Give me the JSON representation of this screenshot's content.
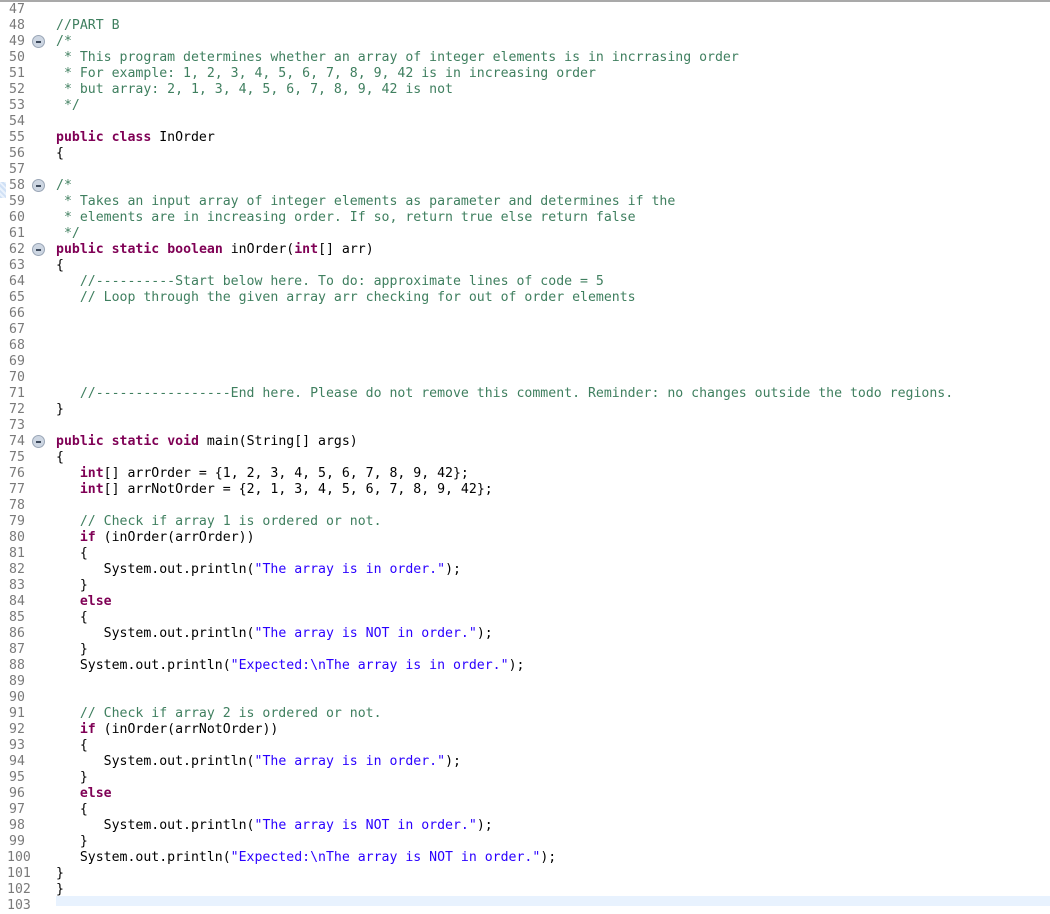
{
  "editor": {
    "lines": [
      {
        "n": "47",
        "fold": false,
        "segs": []
      },
      {
        "n": "48",
        "fold": false,
        "segs": [
          {
            "t": "cm",
            "v": "//PART B"
          }
        ]
      },
      {
        "n": "49",
        "fold": true,
        "segs": [
          {
            "t": "cm",
            "v": "/*"
          }
        ]
      },
      {
        "n": "50",
        "fold": false,
        "segs": [
          {
            "t": "cm",
            "v": " * This program determines whether an array of integer elements is in incrrasing order"
          }
        ]
      },
      {
        "n": "51",
        "fold": false,
        "segs": [
          {
            "t": "cm",
            "v": " * For example: 1, 2, 3, 4, 5, 6, 7, 8, 9, 42 is in increasing order"
          }
        ]
      },
      {
        "n": "52",
        "fold": false,
        "segs": [
          {
            "t": "cm",
            "v": " * but array: 2, 1, 3, 4, 5, 6, 7, 8, 9, 42 is not"
          }
        ]
      },
      {
        "n": "53",
        "fold": false,
        "segs": [
          {
            "t": "cm",
            "v": " */"
          }
        ]
      },
      {
        "n": "54",
        "fold": false,
        "segs": []
      },
      {
        "n": "55",
        "fold": false,
        "segs": [
          {
            "t": "kw",
            "v": "public"
          },
          {
            "t": "",
            "v": " "
          },
          {
            "t": "kw",
            "v": "class"
          },
          {
            "t": "",
            "v": " InOrder"
          }
        ]
      },
      {
        "n": "56",
        "fold": false,
        "segs": [
          {
            "t": "",
            "v": "{"
          }
        ]
      },
      {
        "n": "57",
        "fold": false,
        "segs": []
      },
      {
        "n": "58",
        "fold": true,
        "segs": [
          {
            "t": "cm",
            "v": "/*"
          }
        ]
      },
      {
        "n": "59",
        "fold": false,
        "segs": [
          {
            "t": "cm",
            "v": " * Takes an input array of integer elements as parameter and determines if the"
          }
        ]
      },
      {
        "n": "60",
        "fold": false,
        "segs": [
          {
            "t": "cm",
            "v": " * elements are in increasing order. If so, return true else return false"
          }
        ]
      },
      {
        "n": "61",
        "fold": false,
        "segs": [
          {
            "t": "cm",
            "v": " */"
          }
        ]
      },
      {
        "n": "62",
        "fold": true,
        "segs": [
          {
            "t": "kw",
            "v": "public"
          },
          {
            "t": "",
            "v": " "
          },
          {
            "t": "kw",
            "v": "static"
          },
          {
            "t": "",
            "v": " "
          },
          {
            "t": "kw",
            "v": "boolean"
          },
          {
            "t": "",
            "v": " inOrder("
          },
          {
            "t": "kw",
            "v": "int"
          },
          {
            "t": "",
            "v": "[] arr)"
          }
        ]
      },
      {
        "n": "63",
        "fold": false,
        "segs": [
          {
            "t": "",
            "v": "{"
          }
        ]
      },
      {
        "n": "64",
        "fold": false,
        "segs": [
          {
            "t": "cm",
            "v": "   //----------Start below here. To do: approximate lines of code = 5"
          }
        ]
      },
      {
        "n": "65",
        "fold": false,
        "segs": [
          {
            "t": "cm",
            "v": "   // Loop through the given array arr checking for out of order elements"
          }
        ]
      },
      {
        "n": "66",
        "fold": false,
        "segs": []
      },
      {
        "n": "67",
        "fold": false,
        "segs": []
      },
      {
        "n": "68",
        "fold": false,
        "segs": []
      },
      {
        "n": "69",
        "fold": false,
        "segs": []
      },
      {
        "n": "70",
        "fold": false,
        "segs": []
      },
      {
        "n": "71",
        "fold": false,
        "segs": [
          {
            "t": "cm",
            "v": "   //-----------------End here. Please do not remove this comment. Reminder: no changes outside the todo regions."
          }
        ]
      },
      {
        "n": "72",
        "fold": false,
        "segs": [
          {
            "t": "",
            "v": "}"
          }
        ]
      },
      {
        "n": "73",
        "fold": false,
        "segs": []
      },
      {
        "n": "74",
        "fold": true,
        "segs": [
          {
            "t": "kw",
            "v": "public"
          },
          {
            "t": "",
            "v": " "
          },
          {
            "t": "kw",
            "v": "static"
          },
          {
            "t": "",
            "v": " "
          },
          {
            "t": "kw",
            "v": "void"
          },
          {
            "t": "",
            "v": " main(String[] args)"
          }
        ]
      },
      {
        "n": "75",
        "fold": false,
        "segs": [
          {
            "t": "",
            "v": "{"
          }
        ]
      },
      {
        "n": "76",
        "fold": false,
        "segs": [
          {
            "t": "",
            "v": "   "
          },
          {
            "t": "kw",
            "v": "int"
          },
          {
            "t": "",
            "v": "[] arrOrder = {1, 2, 3, 4, 5, 6, 7, 8, 9, 42};"
          }
        ]
      },
      {
        "n": "77",
        "fold": false,
        "segs": [
          {
            "t": "",
            "v": "   "
          },
          {
            "t": "kw",
            "v": "int"
          },
          {
            "t": "",
            "v": "[] arrNotOrder = {2, 1, 3, 4, 5, 6, 7, 8, 9, 42};"
          }
        ]
      },
      {
        "n": "78",
        "fold": false,
        "segs": []
      },
      {
        "n": "79",
        "fold": false,
        "segs": [
          {
            "t": "cm",
            "v": "   // Check if array 1 is ordered or not."
          }
        ]
      },
      {
        "n": "80",
        "fold": false,
        "segs": [
          {
            "t": "",
            "v": "   "
          },
          {
            "t": "kw",
            "v": "if"
          },
          {
            "t": "",
            "v": " (inOrder(arrOrder))"
          }
        ]
      },
      {
        "n": "81",
        "fold": false,
        "segs": [
          {
            "t": "",
            "v": "   {"
          }
        ]
      },
      {
        "n": "82",
        "fold": false,
        "segs": [
          {
            "t": "",
            "v": "      System.out.println("
          },
          {
            "t": "str",
            "v": "\"The array is in order.\""
          },
          {
            "t": "",
            "v": ");"
          }
        ]
      },
      {
        "n": "83",
        "fold": false,
        "segs": [
          {
            "t": "",
            "v": "   }"
          }
        ]
      },
      {
        "n": "84",
        "fold": false,
        "segs": [
          {
            "t": "",
            "v": "   "
          },
          {
            "t": "kw",
            "v": "else"
          }
        ]
      },
      {
        "n": "85",
        "fold": false,
        "segs": [
          {
            "t": "",
            "v": "   {"
          }
        ]
      },
      {
        "n": "86",
        "fold": false,
        "segs": [
          {
            "t": "",
            "v": "      System.out.println("
          },
          {
            "t": "str",
            "v": "\"The array is NOT in order.\""
          },
          {
            "t": "",
            "v": ");"
          }
        ]
      },
      {
        "n": "87",
        "fold": false,
        "segs": [
          {
            "t": "",
            "v": "   }"
          }
        ]
      },
      {
        "n": "88",
        "fold": false,
        "segs": [
          {
            "t": "",
            "v": "   System.out.println("
          },
          {
            "t": "str",
            "v": "\"Expected:\\nThe array is in order.\""
          },
          {
            "t": "",
            "v": ");"
          }
        ]
      },
      {
        "n": "89",
        "fold": false,
        "segs": []
      },
      {
        "n": "90",
        "fold": false,
        "segs": []
      },
      {
        "n": "91",
        "fold": false,
        "segs": [
          {
            "t": "cm",
            "v": "   // Check if array 2 is ordered or not."
          }
        ]
      },
      {
        "n": "92",
        "fold": false,
        "segs": [
          {
            "t": "",
            "v": "   "
          },
          {
            "t": "kw",
            "v": "if"
          },
          {
            "t": "",
            "v": " (inOrder(arrNotOrder))"
          }
        ]
      },
      {
        "n": "93",
        "fold": false,
        "segs": [
          {
            "t": "",
            "v": "   {"
          }
        ]
      },
      {
        "n": "94",
        "fold": false,
        "segs": [
          {
            "t": "",
            "v": "      System.out.println("
          },
          {
            "t": "str",
            "v": "\"The array is in order.\""
          },
          {
            "t": "",
            "v": ");"
          }
        ]
      },
      {
        "n": "95",
        "fold": false,
        "segs": [
          {
            "t": "",
            "v": "   }"
          }
        ]
      },
      {
        "n": "96",
        "fold": false,
        "segs": [
          {
            "t": "",
            "v": "   "
          },
          {
            "t": "kw",
            "v": "else"
          }
        ]
      },
      {
        "n": "97",
        "fold": false,
        "segs": [
          {
            "t": "",
            "v": "   {"
          }
        ]
      },
      {
        "n": "98",
        "fold": false,
        "segs": [
          {
            "t": "",
            "v": "      System.out.println("
          },
          {
            "t": "str",
            "v": "\"The array is NOT in order.\""
          },
          {
            "t": "",
            "v": ");"
          }
        ]
      },
      {
        "n": "99",
        "fold": false,
        "segs": [
          {
            "t": "",
            "v": "   }"
          }
        ]
      },
      {
        "n": "100",
        "fold": false,
        "segs": [
          {
            "t": "",
            "v": "   System.out.println("
          },
          {
            "t": "str",
            "v": "\"Expected:\\nThe array is NOT in order.\""
          },
          {
            "t": "",
            "v": ");"
          }
        ]
      },
      {
        "n": "101",
        "fold": false,
        "segs": [
          {
            "t": "",
            "v": "}"
          }
        ]
      },
      {
        "n": "102",
        "fold": false,
        "segs": [
          {
            "t": "",
            "v": "}"
          }
        ]
      },
      {
        "n": "103",
        "fold": false,
        "segs": []
      }
    ]
  },
  "colors": {
    "keyword": "#7f0055",
    "comment": "#3f7f5f",
    "string": "#2a00ff",
    "line_number": "#7a7a7a",
    "current_line": "#e8f2fe"
  }
}
